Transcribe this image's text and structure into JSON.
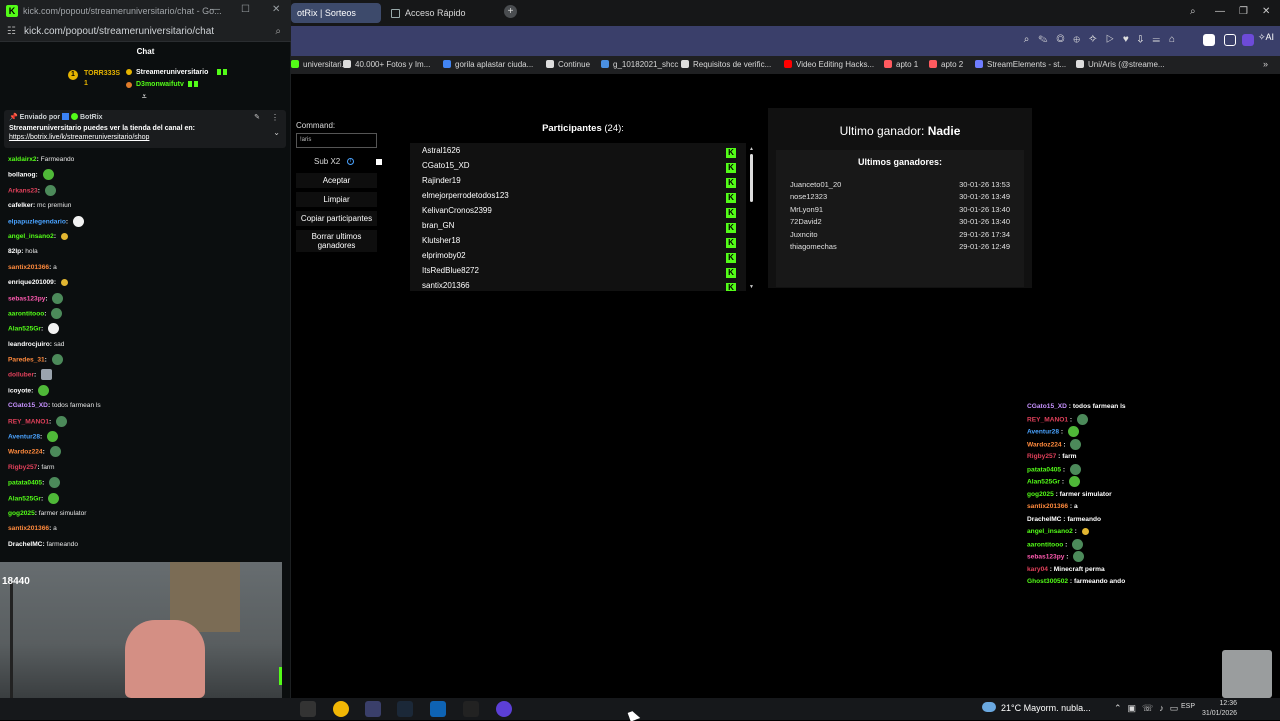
{
  "popup": {
    "title": "kick.com/popout/streameruniversitario/chat - Go...",
    "url": "kick.com/popout/streameruniversitario/chat",
    "header": "Chat",
    "gifters": {
      "first": "TORR333S",
      "first_count": "1",
      "second": "Streameruniversitario",
      "third": "D3monwaifutv"
    },
    "pinned": {
      "by_label": "Enviado por",
      "by_user": "BotRix",
      "message": "Streameruniversitario puedes ver la tienda del canal en:",
      "link": "https://botrix.live/k/streameruniversitario/shop"
    },
    "messages": [
      {
        "user": "xaldairx2",
        "color": "#53fc18",
        "text": "Farmeando",
        "emote": ""
      },
      {
        "user": "bollanog",
        "color": "#ffffff",
        "text": "",
        "emote": "green"
      },
      {
        "user": "Arkans23",
        "color": "#e0405a",
        "text": "",
        "emote": "frog"
      },
      {
        "user": "cafelker",
        "color": "#ffffff",
        "text": "mc premiun",
        "emote": ""
      },
      {
        "user": "elpapuzlegendario",
        "color": "#4aa3ff",
        "text": "",
        "emote": "white"
      },
      {
        "user": "angel_insano2",
        "color": "#53fc18",
        "text": "",
        "emote": "smile"
      },
      {
        "user": "82lp",
        "color": "#ffffff",
        "text": "hola",
        "emote": ""
      },
      {
        "user": "santix201366",
        "color": "#ff8a3d",
        "text": "a",
        "emote": ""
      },
      {
        "user": "enrique201009",
        "color": "#ffffff",
        "text": "",
        "emote": "smile"
      },
      {
        "user": "sebas123py",
        "color": "#ff5ab0",
        "text": "",
        "emote": "frog"
      },
      {
        "user": "aarontitooo",
        "color": "#53fc18",
        "text": "",
        "emote": "frog"
      },
      {
        "user": "Alan525Gr",
        "color": "#53fc18",
        "text": "",
        "emote": "white"
      },
      {
        "user": "leandrocjuiro",
        "color": "#ffffff",
        "text": "sad",
        "emote": ""
      },
      {
        "user": "Paredes_31",
        "color": "#ff8a3d",
        "text": "",
        "emote": "frog"
      },
      {
        "user": "dolluber",
        "color": "#e0405a",
        "text": "",
        "emote": "gray"
      },
      {
        "user": "icoyote",
        "color": "#ffffff",
        "text": "",
        "emote": "green"
      },
      {
        "user": "CGato15_XD",
        "color": "#c792ff",
        "text": "todos farmean ls",
        "emote": ""
      },
      {
        "user": "REY_MANO1",
        "color": "#e0405a",
        "text": "",
        "emote": "frog"
      },
      {
        "user": "Aventur28",
        "color": "#4aa3ff",
        "text": "",
        "emote": "green"
      },
      {
        "user": "Wardoz224",
        "color": "#ff8a3d",
        "text": "",
        "emote": "frog"
      },
      {
        "user": "Rigby257",
        "color": "#e0405a",
        "text": "farm",
        "emote": ""
      },
      {
        "user": "patata0405",
        "color": "#53fc18",
        "text": "",
        "emote": "frog"
      },
      {
        "user": "Alan525Gr",
        "color": "#53fc18",
        "text": "",
        "emote": "green"
      },
      {
        "user": "gog2025",
        "color": "#53fc18",
        "text": "farmer simulator",
        "emote": ""
      },
      {
        "user": "santix201366",
        "color": "#ff8a3d",
        "text": "a",
        "emote": ""
      },
      {
        "user": "DrachelMC",
        "color": "#ffffff",
        "text": "farmeando",
        "emote": ""
      }
    ],
    "webcam_counter": "18440"
  },
  "browser": {
    "tabs": [
      {
        "label": "otRix | Sorteos",
        "active": true
      },
      {
        "label": "Acceso Rápido",
        "active": false
      }
    ],
    "ai_label": "AI",
    "bookmarks": [
      {
        "label": "universitari...",
        "color": "#53fc18"
      },
      {
        "label": "40.000+ Fotos y Im...",
        "color": "#dddddd"
      },
      {
        "label": "gorila aplastar ciuda...",
        "color": "#4285f4"
      },
      {
        "label": "Continue",
        "color": "#dddddd"
      },
      {
        "label": "g_10182021_shcc",
        "color": "#4a90e2"
      },
      {
        "label": "Requisitos de verific...",
        "color": "#dddddd"
      },
      {
        "label": "Video Editing Hacks...",
        "color": "#ff0000"
      },
      {
        "label": "apto 1",
        "color": "#ff5a5f"
      },
      {
        "label": "apto 2",
        "color": "#ff5a5f"
      },
      {
        "label": "StreamElements - st...",
        "color": "#6f7dff"
      },
      {
        "label": "Uni/Aris (@streame...",
        "color": "#dddddd"
      }
    ]
  },
  "sorteos": {
    "command_label": "Command:",
    "command_value": "!aris",
    "sub_label": "Sub X2",
    "info_glyph": "i",
    "buttons": {
      "accept": "Aceptar",
      "clear": "Limpiar",
      "copy": "Copiar participantes",
      "delete_winners": "Borrar ultimos ganadores"
    },
    "participants_label": "Participantes",
    "participants_count": "(24):",
    "participants": [
      "Astral1626",
      "CGato15_XD",
      "Rajinder19",
      "elmejorperrodetodos123",
      "KelivanCronos2399",
      "bran_GN",
      "Klutsher18",
      "elprimoby02",
      "ItsRedBlue8272",
      "santix201366"
    ],
    "platform_glyph": "K",
    "last_winner_label": "Ultimo ganador:",
    "last_winner_value": "Nadie",
    "winners_title": "Ultimos ganadores:",
    "winners": [
      {
        "name": "Juanceto01_20",
        "date": "30-01-26 13:53"
      },
      {
        "name": "nose12323",
        "date": "30-01-26 13:49"
      },
      {
        "name": "MrLyon91",
        "date": "30-01-26 13:40"
      },
      {
        "name": "72David2",
        "date": "30-01-26 13:40"
      },
      {
        "name": "Juxncito",
        "date": "29-01-26 17:34"
      },
      {
        "name": "thiagomechas",
        "date": "29-01-26 12:49"
      }
    ]
  },
  "overlay_chat": [
    {
      "user": "CGato15_XD",
      "color": "#c792ff",
      "text": "todos farmean ls",
      "emote": ""
    },
    {
      "user": "REY_MANO1",
      "color": "#e0405a",
      "text": "",
      "emote": "frog"
    },
    {
      "user": "Aventur28",
      "color": "#4aa3ff",
      "text": "",
      "emote": "green"
    },
    {
      "user": "Wardoz224",
      "color": "#ff8a3d",
      "text": "",
      "emote": "frog"
    },
    {
      "user": "Rigby257",
      "color": "#e0405a",
      "text": "farm",
      "emote": ""
    },
    {
      "user": "patata0405",
      "color": "#53fc18",
      "text": "",
      "emote": "frog"
    },
    {
      "user": "Alan525Gr",
      "color": "#53fc18",
      "text": "",
      "emote": "green"
    },
    {
      "user": "gog2025",
      "color": "#53fc18",
      "text": "farmer simulator",
      "emote": ""
    },
    {
      "user": "santix201366",
      "color": "#ff8a3d",
      "text": "a",
      "emote": ""
    },
    {
      "user": "DrachelMC",
      "color": "#ffffff",
      "text": "farmeando",
      "emote": ""
    },
    {
      "user": "angel_insano2",
      "color": "#53fc18",
      "text": "",
      "emote": "smile"
    },
    {
      "user": "aarontitooo",
      "color": "#53fc18",
      "text": "",
      "emote": "frog"
    },
    {
      "user": "sebas123py",
      "color": "#ff5ab0",
      "text": "",
      "emote": "frog"
    },
    {
      "user": "kary04",
      "color": "#e0405a",
      "text": "Minecraft perma",
      "emote": ""
    },
    {
      "user": "Ghost300502",
      "color": "#53fc18",
      "text": "farmeando ando",
      "emote": ""
    }
  ],
  "taskbar": {
    "weather": "21°C  Mayorm. nubla...",
    "language": "ESP",
    "time": "12:36",
    "date": "31/01/2026"
  }
}
